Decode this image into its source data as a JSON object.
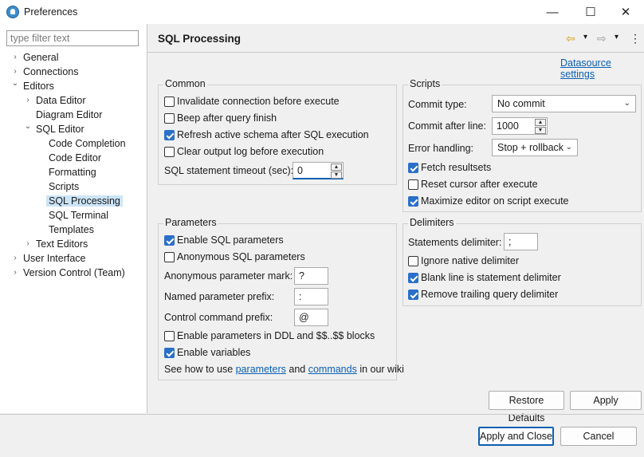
{
  "window": {
    "title": "Preferences",
    "minimize_glyph": "—",
    "maximize_glyph": "☐",
    "close_glyph": "✕"
  },
  "filter": {
    "placeholder": "type filter text",
    "value": ""
  },
  "tree": [
    {
      "label": "General",
      "arrow": "›"
    },
    {
      "label": "Connections",
      "arrow": "›"
    },
    {
      "label": "Editors",
      "arrow": "⌄"
    },
    {
      "label": "Data Editor",
      "arrow": "›"
    },
    {
      "label": "Diagram Editor",
      "arrow": ""
    },
    {
      "label": "SQL Editor",
      "arrow": "⌄"
    },
    {
      "label": "Code Completion",
      "arrow": ""
    },
    {
      "label": "Code Editor",
      "arrow": ""
    },
    {
      "label": "Formatting",
      "arrow": ""
    },
    {
      "label": "Scripts",
      "arrow": ""
    },
    {
      "label": "SQL Processing",
      "arrow": ""
    },
    {
      "label": "SQL Terminal",
      "arrow": ""
    },
    {
      "label": "Templates",
      "arrow": ""
    },
    {
      "label": "Text Editors",
      "arrow": "›"
    },
    {
      "label": "User Interface",
      "arrow": "›"
    },
    {
      "label": "Version Control (Team)",
      "arrow": "›"
    }
  ],
  "page": {
    "title": "SQL Processing",
    "datasource_link": "Datasource settings",
    "nav_back_glyph": "⇦",
    "nav_fwd_glyph": "⇨",
    "dropdown_glyph": "▾",
    "menu_glyph": "⋮"
  },
  "common": {
    "title": "Common",
    "invalidate": {
      "label": "Invalidate connection before execute",
      "checked": false
    },
    "beep": {
      "label": "Beep after query finish",
      "checked": false
    },
    "refresh": {
      "label": "Refresh active schema after SQL execution",
      "checked": true
    },
    "clear_log": {
      "label": "Clear output log before execution",
      "checked": false
    },
    "timeout_label": "SQL statement timeout (sec):",
    "timeout_value": "0"
  },
  "scripts": {
    "title": "Scripts",
    "commit_type_label": "Commit type:",
    "commit_type_value": "No commit",
    "commit_after_label": "Commit after line:",
    "commit_after_value": "1000",
    "error_handling_label": "Error handling:",
    "error_handling_value": "Stop + rollback",
    "fetch": {
      "label": "Fetch resultsets",
      "checked": true
    },
    "reset_cursor": {
      "label": "Reset cursor after execute",
      "checked": false
    },
    "maximize": {
      "label": "Maximize editor on script execute",
      "checked": true
    }
  },
  "parameters": {
    "title": "Parameters",
    "enable_sql": {
      "label": "Enable SQL parameters",
      "checked": true
    },
    "anonymous_sql": {
      "label": "Anonymous SQL parameters",
      "checked": false
    },
    "anon_mark_label": "Anonymous parameter mark:",
    "anon_mark_value": "?",
    "named_prefix_label": "Named parameter prefix:",
    "named_prefix_value": ":",
    "control_prefix_label": "Control command prefix:",
    "control_prefix_value": "@",
    "ddl": {
      "label": "Enable parameters in DDL and $$..$$ blocks",
      "checked": false
    },
    "variables": {
      "label": "Enable variables",
      "checked": true
    },
    "wiki_prefix": "See how to use ",
    "wiki_parameters": "parameters",
    "wiki_and": " and ",
    "wiki_commands": "commands",
    "wiki_suffix": " in our wiki"
  },
  "delimiters": {
    "title": "Delimiters",
    "statements_label": "Statements delimiter:",
    "statements_value": ";",
    "ignore_native": {
      "label": "Ignore native delimiter",
      "checked": false
    },
    "blank_line": {
      "label": "Blank line is statement delimiter",
      "checked": true
    },
    "remove_trailing": {
      "label": "Remove trailing query delimiter",
      "checked": true
    }
  },
  "buttons": {
    "restore_defaults": "Restore Defaults",
    "apply": "Apply",
    "apply_close": "Apply and Close",
    "cancel": "Cancel"
  },
  "colors": {
    "accent": "#2a6fc9",
    "link": "#0b5fb2",
    "selection": "#cce4f7"
  }
}
